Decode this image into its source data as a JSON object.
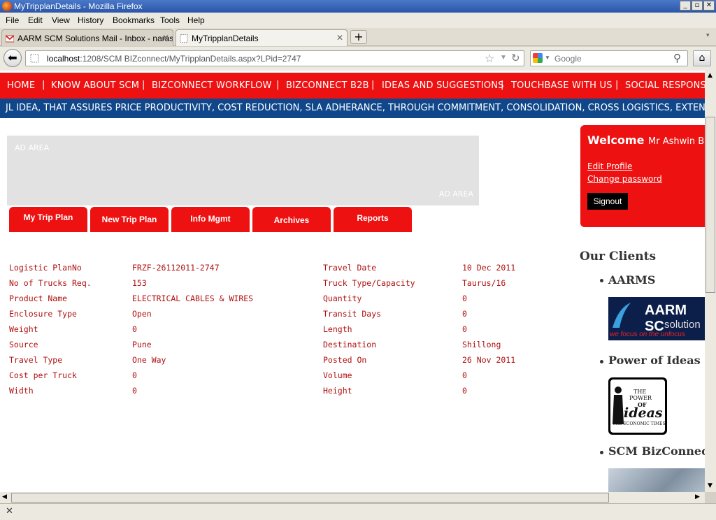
{
  "window": {
    "title": "MyTripplanDetails - Mozilla Firefox",
    "buttons": [
      "_",
      "▫",
      "✕"
    ]
  },
  "menu": [
    "File",
    "Edit",
    "View",
    "History",
    "Bookmarks",
    "Tools",
    "Help"
  ],
  "tabs": [
    {
      "label": "AARM SCM Solutions Mail - Inbox - narasi...",
      "active": false
    },
    {
      "label": "MyTripplanDetails",
      "active": true
    }
  ],
  "address": {
    "host": "localhost",
    "path": ":1208/SCM BIZconnect/MyTripplanDetails.aspx?LPid=2747"
  },
  "search": {
    "placeholder": "Google"
  },
  "site_nav": [
    "HOME",
    "KNOW ABOUT SCM",
    "BIZCONNECT WORKFLOW",
    "BIZCONNECT B2B",
    "IDEAS AND SUGGESTIONS",
    "TOUCHBASE WITH US",
    "SOCIAL RESPONSI"
  ],
  "ticker": "JL IDEA, THAT ASSURES PRICE PRODUCTIVITY, COST REDUCTION, SLA ADHERANCE, THROUGH COMMITMENT, CONSOLIDATION, CROSS LOGISTICS, EXTENDED COM",
  "ad": {
    "label_top": "AD AREA",
    "label_bottom": "AD AREA"
  },
  "trip_tabs": [
    "My Trip Plan",
    "New Trip Plan",
    "Info Mgmt",
    "Archives",
    "Reports"
  ],
  "details_left": [
    {
      "label": "Logistic PlanNo",
      "value": "FRZF-26112011-2747"
    },
    {
      "label": "No of Trucks Req.",
      "value": "153"
    },
    {
      "label": "Product Name",
      "value": "ELECTRICAL CABLES & WIRES"
    },
    {
      "label": "Enclosure Type",
      "value": "Open"
    },
    {
      "label": "Weight",
      "value": "0"
    },
    {
      "label": "Source",
      "value": "Pune"
    },
    {
      "label": "Travel Type",
      "value": "One Way"
    },
    {
      "label": "Cost per Truck",
      "value": "0"
    },
    {
      "label": "Width",
      "value": "0"
    }
  ],
  "details_right": [
    {
      "label": "Travel Date",
      "value": "10 Dec 2011"
    },
    {
      "label": "Truck Type/Capacity",
      "value": "Taurus/16"
    },
    {
      "label": "Quantity",
      "value": "0"
    },
    {
      "label": "Transit Days",
      "value": "0"
    },
    {
      "label": "Length",
      "value": "0"
    },
    {
      "label": "Destination",
      "value": "Shillong"
    },
    {
      "label": "Posted On",
      "value": "26 Nov 2011"
    },
    {
      "label": "Volume",
      "value": "0"
    },
    {
      "label": "Height",
      "value": "0"
    }
  ],
  "welcome": {
    "greeting": "Welcome",
    "user": "Mr Ashwin Bal",
    "edit_profile": "Edit Profile",
    "change_password": "Change password",
    "signout": "Signout"
  },
  "clients": {
    "heading": "Our Clients",
    "items": [
      "AARMS",
      "Power of Ideas",
      "SCM BizConnect"
    ],
    "aarm_logo_text": "AARM SC",
    "aarm_logo_sub": "solution",
    "aarm_logo_tag": "we focus on the unfocus",
    "ideas_logo_text": [
      "THE",
      "POWER",
      "OF",
      "ideas",
      "THE ECONOMIC TIMES"
    ]
  },
  "colors": {
    "brand_red": "#ee1111",
    "ticker_blue": "#10478b",
    "detail_text": "#b01010"
  }
}
